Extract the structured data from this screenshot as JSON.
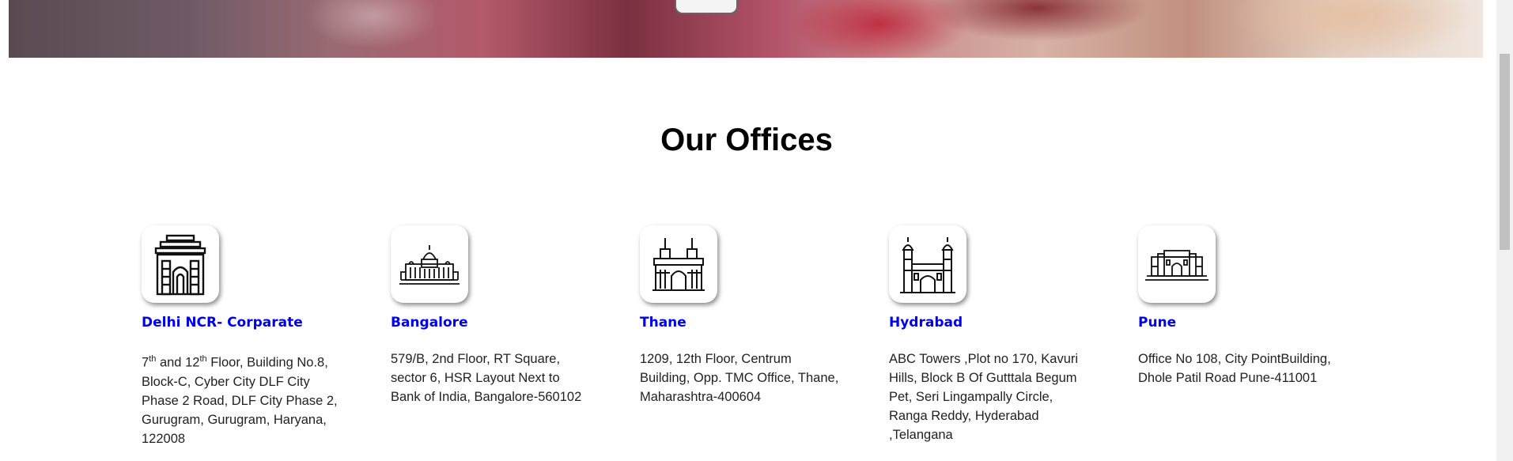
{
  "section_title": "Our Offices",
  "offices": [
    {
      "city": "Delhi NCR- Corparate",
      "address_lines": [
        "Floor, Building No.8,",
        "Block-C, Cyber City DLF City",
        "Phase 2 Road, DLF City Phase 2,",
        "Gurugram, Gurugram, Haryana,",
        "122008"
      ],
      "floor_a": "7",
      "sup_a": "th",
      "and": " and ",
      "floor_b": "12",
      "sup_b": "th",
      "icon": "india-gate-icon"
    },
    {
      "city": "Bangalore",
      "address_lines": [
        "579/B, 2nd Floor, RT Square,",
        "sector 6, HSR Layout Next to",
        "Bank of India, Bangalore-560102"
      ],
      "icon": "vidhana-soudha-icon"
    },
    {
      "city": "Thane",
      "address_lines": [
        "1209, 12th Floor, Centrum",
        "Building, Opp. TMC Office, Thane,",
        "Maharashtra-400604"
      ],
      "icon": "gateway-of-india-icon"
    },
    {
      "city": "Hydrabad",
      "address_lines": [
        "ABC Towers ,Plot no 170, Kavuri",
        "Hills, Block B Of Gutttala Begum",
        "Pet, Seri Lingampally Circle,",
        "Ranga Reddy, Hyderabad",
        ",Telangana"
      ],
      "icon": "charminar-icon"
    },
    {
      "city": "Pune",
      "address_lines": [
        "Office No 108, City PointBuilding,",
        "Dhole Patil Road Pune-411001"
      ],
      "icon": "shaniwar-wada-icon"
    }
  ]
}
